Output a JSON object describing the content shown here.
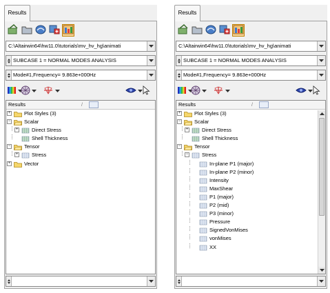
{
  "panels": [
    {
      "tab_label": "Results",
      "path": "C:\\Altairwin64\\hw11.0\\tutorials\\mv_hv_hg\\animati",
      "subcase": "SUBCASE 1 = NORMAL MODES ANALYSIS",
      "mode": "Mode#1,Frequency=  9.863e+000Hz",
      "tree_header": "Results",
      "tree_header_sep": "/",
      "bottom_value": "",
      "rows": [
        {
          "label": "Plot Styles (3)",
          "level": 0,
          "kind": "folder",
          "expander": "+"
        },
        {
          "label": "Scalar",
          "level": 0,
          "kind": "folder",
          "expander": "-"
        },
        {
          "label": "Direct Stress",
          "level": 1,
          "kind": "leaf",
          "expander": "+"
        },
        {
          "label": "Shell Thickness",
          "level": 1,
          "kind": "leaf",
          "expander": ""
        },
        {
          "label": "Tensor",
          "level": 0,
          "kind": "folder",
          "expander": "-"
        },
        {
          "label": "Stress",
          "level": 1,
          "kind": "leaf",
          "expander": "+"
        },
        {
          "label": "Vector",
          "level": 0,
          "kind": "folder",
          "expander": "+"
        }
      ]
    },
    {
      "tab_label": "Results",
      "path": "C:\\Altairwin64\\hw11.0\\tutorials\\mv_hv_hg\\animati",
      "subcase": "SUBCASE 1 = NORMAL MODES ANALYSIS",
      "mode": "Mode#1,Frequency=  9.863e+000Hz",
      "tree_header": "Results",
      "tree_header_sep": "/",
      "bottom_value": "",
      "rows": [
        {
          "label": "Plot Styles (3)",
          "level": 0,
          "kind": "folder",
          "expander": "+"
        },
        {
          "label": "Scalar",
          "level": 0,
          "kind": "folder",
          "expander": "-"
        },
        {
          "label": "Direct Stress",
          "level": 1,
          "kind": "leaf",
          "expander": "+"
        },
        {
          "label": "Shell Thickness",
          "level": 1,
          "kind": "leaf",
          "expander": ""
        },
        {
          "label": "Tensor",
          "level": 0,
          "kind": "folder",
          "expander": "-"
        },
        {
          "label": "Stress",
          "level": 1,
          "kind": "leaf",
          "expander": "-"
        },
        {
          "label": "In-plane P1 (major)",
          "level": 2,
          "kind": "leaf",
          "expander": ""
        },
        {
          "label": "In-plane P2 (minor)",
          "level": 2,
          "kind": "leaf",
          "expander": ""
        },
        {
          "label": "Intensity",
          "level": 2,
          "kind": "leaf",
          "expander": ""
        },
        {
          "label": "MaxShear",
          "level": 2,
          "kind": "leaf",
          "expander": ""
        },
        {
          "label": "P1 (major)",
          "level": 2,
          "kind": "leaf",
          "expander": ""
        },
        {
          "label": "P2 (mid)",
          "level": 2,
          "kind": "leaf",
          "expander": ""
        },
        {
          "label": "P3 (minor)",
          "level": 2,
          "kind": "leaf",
          "expander": ""
        },
        {
          "label": "Pressure",
          "level": 2,
          "kind": "leaf",
          "expander": ""
        },
        {
          "label": "SignedVonMises",
          "level": 2,
          "kind": "leaf",
          "expander": ""
        },
        {
          "label": "vonMises",
          "level": 2,
          "kind": "leaf",
          "expander": ""
        },
        {
          "label": "XX",
          "level": 2,
          "kind": "leaf",
          "expander": ""
        }
      ]
    }
  ],
  "colors": {
    "folder_fill": "#f5d66b",
    "folder_edge": "#b08a20",
    "leaf_tensor": "#c9d4e6",
    "leaf_scalar": "#9cc4a8",
    "accent_orange": "#f0a030"
  },
  "icons": {
    "toolbar": [
      "load-results-icon",
      "folder-icon",
      "contour-display-icon",
      "add-results-icon",
      "results-browser-icon"
    ],
    "row2": [
      "contour-legend-icon",
      "mesh-sphere-icon",
      "vector-arrows-icon",
      "entity-view-icon",
      "select-pointer-icon"
    ]
  }
}
